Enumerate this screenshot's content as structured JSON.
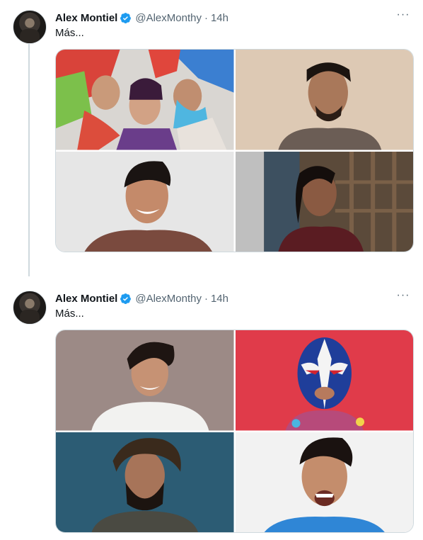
{
  "tweets": [
    {
      "display_name": "Alex Montiel",
      "handle": "@AlexMonthy",
      "separator": "·",
      "timestamp": "14h",
      "text": "Más...",
      "more_label": "···",
      "photos": [
        "group-photo",
        "man-portrait",
        "smiling-man",
        "long-haired-man"
      ]
    },
    {
      "display_name": "Alex Montiel",
      "handle": "@AlexMonthy",
      "separator": "·",
      "timestamp": "14h",
      "text": "Más...",
      "more_label": "···",
      "photos": [
        "young-man-white-shirt",
        "luchador-mask",
        "bearded-man",
        "laughing-man"
      ]
    }
  ],
  "colors": {
    "verified": "#1d9bf0",
    "secondary_text": "#536471",
    "thread_line": "#cfd9de"
  }
}
